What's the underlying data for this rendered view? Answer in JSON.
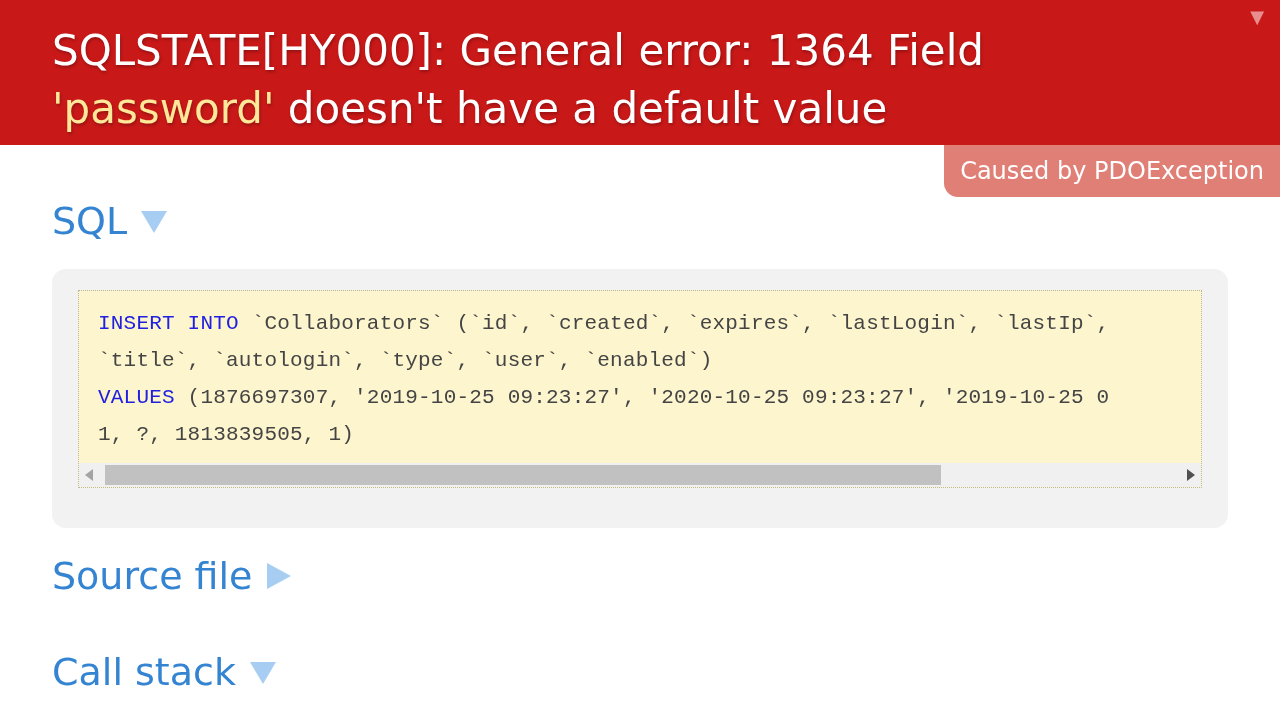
{
  "error": {
    "title_parts": [
      {
        "kind": "plain",
        "text": "SQLSTATE[HY000]: General error: 1364 Field"
      },
      {
        "kind": "quoted",
        "text": "'password'"
      },
      {
        "kind": "plain",
        "text": "doesn't have a default value"
      }
    ],
    "collapse_toggle": "▼",
    "caused_by": "Caused by PDOException"
  },
  "sections": [
    {
      "title": "SQL",
      "expanded": true,
      "kind": "code",
      "lines": [
        [
          {
            "kind": "keyword",
            "text": "INSERT INTO"
          },
          {
            "kind": "plain",
            "text": " `Collaborators` (`id`, `created`, `expires`, `lastLogin`, `lastIp`,"
          }
        ],
        [
          {
            "kind": "plain",
            "text": "`title`, `autologin`, `type`, `user`, `enabled`)"
          }
        ],
        [
          {
            "kind": "keyword",
            "text": "VALUES"
          },
          {
            "kind": "plain",
            "text": " (1876697307, '2019-10-25 09:23:27', '2020-10-25 09:23:27', '2019-10-25 0"
          }
        ],
        [
          {
            "kind": "plain",
            "text": "1, ?, 1813839505, 1)"
          }
        ]
      ]
    },
    {
      "title": "Source file",
      "expanded": false
    },
    {
      "title": "Call stack",
      "expanded": true
    }
  ]
}
